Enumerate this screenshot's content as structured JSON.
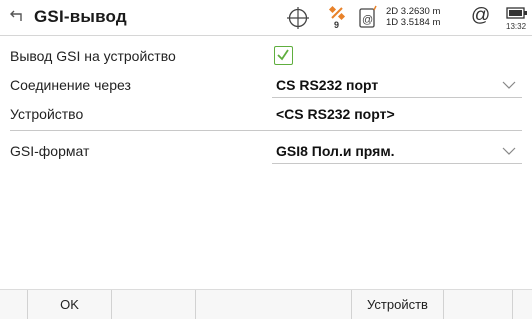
{
  "header": {
    "title": "GSI-вывод",
    "back_icon": "back-arrow-icon",
    "status": {
      "satellites": "9",
      "coord_2d": "2D 3.2630 m",
      "coord_1d": "1D 3.5184 m",
      "at_symbol": "@",
      "time": "13:32"
    }
  },
  "form": {
    "gsi_output": {
      "label": "Вывод GSI на устройство",
      "checked": true
    },
    "connection": {
      "label": "Соединение через",
      "value": "CS RS232 порт"
    },
    "device": {
      "label": "Устройство",
      "value": "<CS RS232 порт>"
    },
    "gsi_format": {
      "label": "GSI-формат",
      "value": "GSI8 Пол.и прям."
    }
  },
  "softkeys": {
    "f1": "OK",
    "f2": "",
    "f3": "",
    "f4": "Устройств",
    "f5": "",
    "f6": ""
  },
  "colors": {
    "checkbox_green": "#5fae3e",
    "sat_orange": "#e8822a"
  }
}
